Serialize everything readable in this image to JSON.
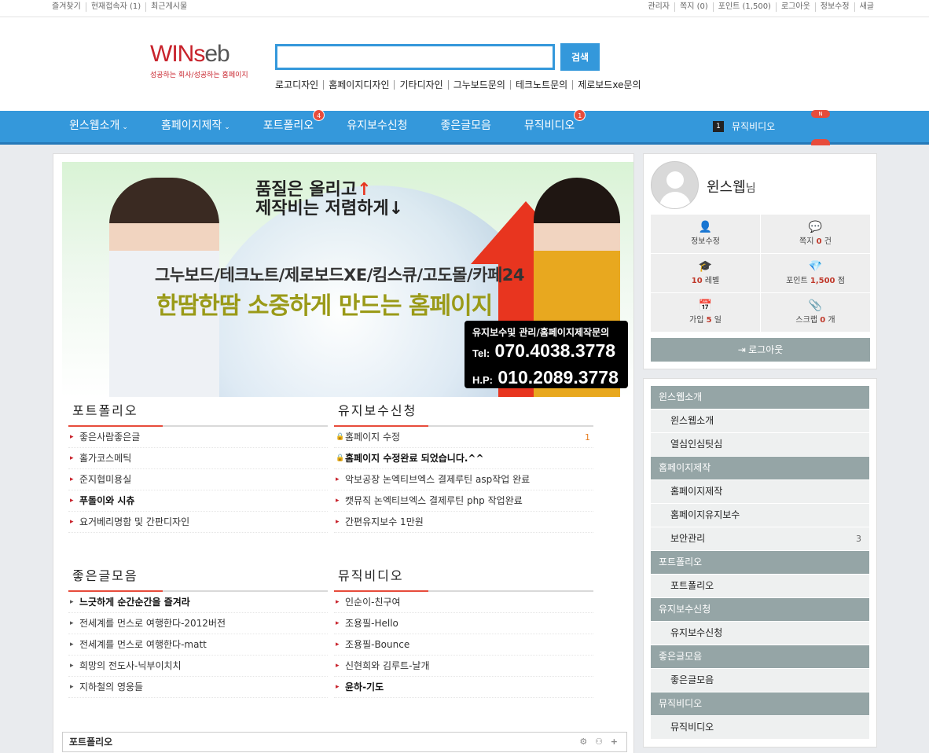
{
  "util": {
    "left": [
      "즐겨찾기",
      "현재접속자 (1)",
      "최근게시물"
    ],
    "right": [
      "관리자",
      "쪽지 (0)",
      "포인트 (1,500)",
      "로그아웃",
      "정보수정",
      "새글"
    ]
  },
  "logo": {
    "brand_a": "WINs",
    "brand_b": "eb",
    "tagline": "성공하는 회사/성공하는 홈페이지"
  },
  "search": {
    "value": "",
    "button": "검색"
  },
  "quick_links": [
    "로고디자인",
    "홈페이지디자인",
    "기타디자인",
    "그누보드문의",
    "테크노트문의",
    "제로보드xe문의"
  ],
  "nav": {
    "items": [
      {
        "label": "윈스웹소개",
        "caret": "⌄",
        "badge": ""
      },
      {
        "label": "홈페이지제작",
        "caret": "⌄",
        "badge": ""
      },
      {
        "label": "포트폴리오",
        "caret": "",
        "badge": "4"
      },
      {
        "label": "유지보수신청",
        "caret": "",
        "badge": ""
      },
      {
        "label": "좋은글모음",
        "caret": "",
        "badge": ""
      },
      {
        "label": "뮤직비디오",
        "caret": "",
        "badge": "1"
      }
    ],
    "rank_num": "1",
    "rank_label": "뮤직비디오",
    "rank_badge": "N"
  },
  "banner": {
    "line1": "품질은 올리고",
    "up": "↑",
    "line2": "제작비는 저렴하게",
    "down": "↓",
    "line3": "그누보드/테크노트/제로보드XE/킴스큐/고도몰/카페24",
    "line4": "한땀한땀 소중하게 만드는 홈페이지",
    "call_title": "유지보수및 관리/홈페이지제작문의",
    "tel_label": "Tel:",
    "tel": "070.4038.3778",
    "hp_label": "H.P:",
    "hp": "010.2089.3778"
  },
  "boards": [
    {
      "title": "포트폴리오",
      "items": [
        {
          "text": "좋은사람좋은글",
          "bold": false,
          "marker": "▸",
          "count": ""
        },
        {
          "text": "홀가코스메틱",
          "bold": false,
          "marker": "▸",
          "count": ""
        },
        {
          "text": "준지협미용실",
          "bold": false,
          "marker": "▸",
          "count": ""
        },
        {
          "text": "푸돌이와 시츄",
          "bold": true,
          "marker": "▸",
          "count": ""
        },
        {
          "text": "요거베리명함 및 간판디자인",
          "bold": false,
          "marker": "▸",
          "count": ""
        }
      ]
    },
    {
      "title": "유지보수신청",
      "items": [
        {
          "text": "홈페이지 수정",
          "bold": false,
          "marker": "🔒",
          "count": "1"
        },
        {
          "text": "홈페이지 수정완료 되었습니다.^^",
          "bold": true,
          "marker": "🔒",
          "count": ""
        },
        {
          "text": "악보공장 논엑티브엑스 결제루틴 asp작업 완료",
          "bold": false,
          "marker": "▸",
          "count": ""
        },
        {
          "text": "캣뮤직 논엑티브엑스 결제루틴 php 작업완료",
          "bold": false,
          "marker": "▸",
          "count": ""
        },
        {
          "text": "간편유지보수 1만원",
          "bold": false,
          "marker": "▸",
          "count": ""
        }
      ]
    },
    {
      "title": "좋은글모음",
      "items": [
        {
          "text": "느긋하게 순간순간을 즐겨라",
          "bold": true,
          "marker": "▸",
          "count": ""
        },
        {
          "text": "전세계를 먼스로 여행한다-2012버전",
          "bold": false,
          "marker": "▸",
          "count": ""
        },
        {
          "text": "전세계를 먼스로 여행한다-matt",
          "bold": false,
          "marker": "▸",
          "count": ""
        },
        {
          "text": "희망의 전도사-닉부이치치",
          "bold": false,
          "marker": "▸",
          "count": ""
        },
        {
          "text": "지하철의 영웅들",
          "bold": false,
          "marker": "▸",
          "count": ""
        }
      ]
    },
    {
      "title": "뮤직비디오",
      "items": [
        {
          "text": "인순이-친구여",
          "bold": false,
          "marker": "▸",
          "count": ""
        },
        {
          "text": "조용필-Hello",
          "bold": false,
          "marker": "▸",
          "count": ""
        },
        {
          "text": "조용필-Bounce",
          "bold": false,
          "marker": "▸",
          "count": ""
        },
        {
          "text": "신현희와 김루트-날개",
          "bold": false,
          "marker": "▸",
          "count": ""
        },
        {
          "text": "윤하-기도",
          "bold": true,
          "marker": "▸",
          "count": ""
        }
      ]
    }
  ],
  "bottom_strip": {
    "title": "포트폴리오",
    "tools": "⚙ ⚇ +"
  },
  "profile": {
    "name": "윈스웹",
    "suffix": "님",
    "stats": [
      {
        "icon": "👤",
        "icon_name": "user-plus-icon",
        "pre": "",
        "value": "",
        "post": "정보수정"
      },
      {
        "icon": "💬",
        "icon_name": "comment-icon",
        "pre": "쪽지 ",
        "value": "0",
        "post": " 건"
      },
      {
        "icon": "🎓",
        "icon_name": "graduation-cap-icon",
        "pre": "",
        "value": "10",
        "post": " 레벨"
      },
      {
        "icon": "💎",
        "icon_name": "diamond-icon",
        "pre": "포인트 ",
        "value": "1,500",
        "post": " 점"
      },
      {
        "icon": "📅",
        "icon_name": "calendar-icon",
        "pre": "가입 ",
        "value": "5",
        "post": " 일"
      },
      {
        "icon": "📎",
        "icon_name": "paperclip-icon",
        "pre": "스크랩 ",
        "value": "0",
        "post": " 개"
      }
    ],
    "logout": "로그아웃"
  },
  "side_menu": [
    {
      "type": "cat",
      "label": "윈스웹소개",
      "count": ""
    },
    {
      "type": "item",
      "label": "윈스웹소개",
      "count": ""
    },
    {
      "type": "item",
      "label": "열심인심팃심",
      "count": ""
    },
    {
      "type": "cat",
      "label": "홈페이지제작",
      "count": ""
    },
    {
      "type": "item",
      "label": "홈페이지제작",
      "count": ""
    },
    {
      "type": "item",
      "label": "홈페이지유지보수",
      "count": ""
    },
    {
      "type": "item",
      "label": "보안관리",
      "count": "3"
    },
    {
      "type": "cat",
      "label": "포트폴리오",
      "count": ""
    },
    {
      "type": "item",
      "label": "포트폴리오",
      "count": ""
    },
    {
      "type": "cat",
      "label": "유지보수신청",
      "count": ""
    },
    {
      "type": "item",
      "label": "유지보수신청",
      "count": ""
    },
    {
      "type": "cat",
      "label": "좋은글모음",
      "count": ""
    },
    {
      "type": "item",
      "label": "좋은글모음",
      "count": ""
    },
    {
      "type": "cat",
      "label": "뮤직비디오",
      "count": ""
    },
    {
      "type": "item",
      "label": "뮤직비디오",
      "count": ""
    }
  ]
}
